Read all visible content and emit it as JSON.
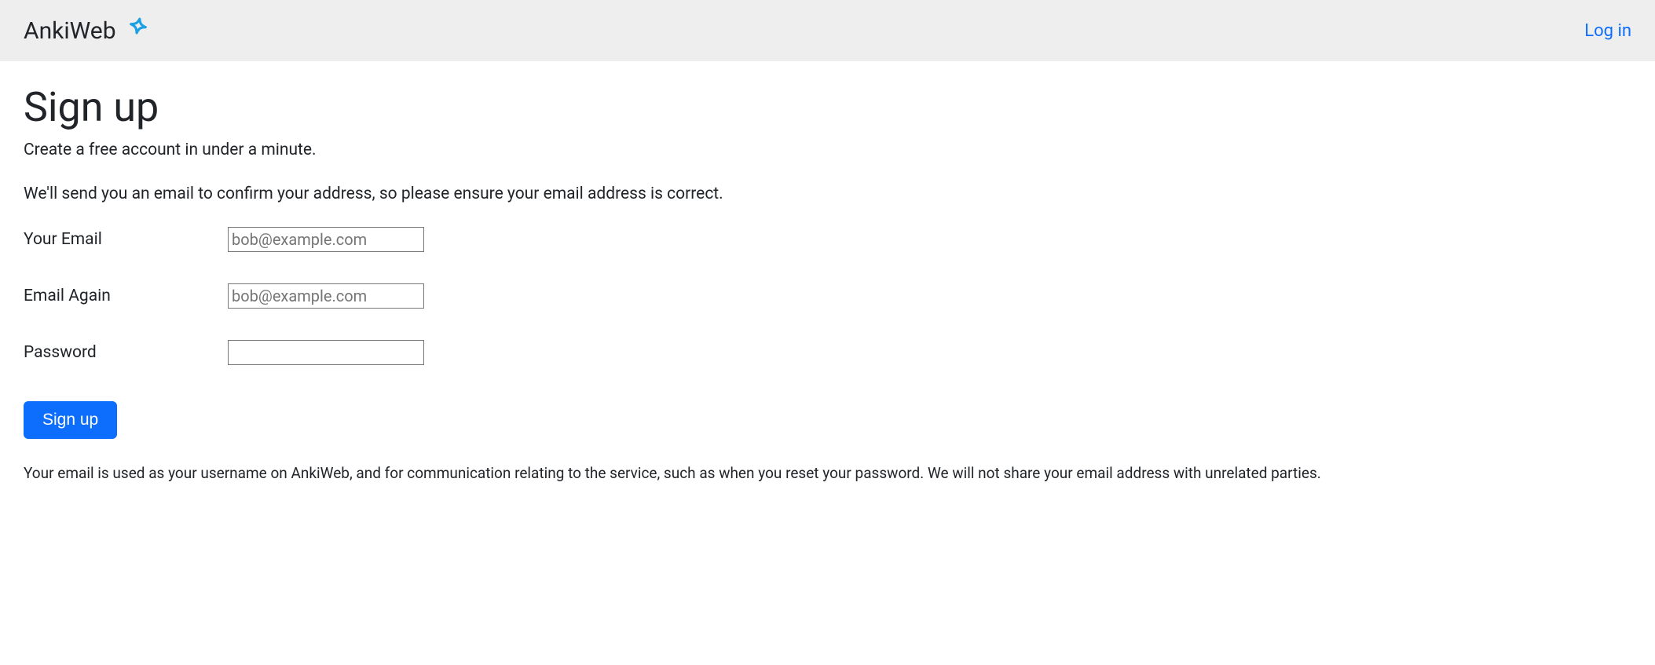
{
  "header": {
    "brand": "AnkiWeb",
    "login_link": "Log in"
  },
  "page": {
    "title": "Sign up",
    "subtitle": "Create a free account in under a minute.",
    "info": "We'll send you an email to confirm your address, so please ensure your email address is correct."
  },
  "form": {
    "email_label": "Your Email",
    "email_placeholder": "bob@example.com",
    "email_value": "",
    "email_again_label": "Email Again",
    "email_again_placeholder": "bob@example.com",
    "email_again_value": "",
    "password_label": "Password",
    "password_value": "",
    "submit_label": "Sign up"
  },
  "footer": {
    "privacy_text": "Your email is used as your username on AnkiWeb, and for communication relating to the service, such as when you reset your password. We will not share your email address with unrelated parties."
  }
}
